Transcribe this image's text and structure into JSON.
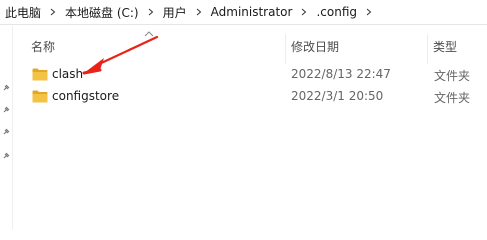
{
  "breadcrumb": [
    {
      "label": "此电脑"
    },
    {
      "label": "本地磁盘 (C:)"
    },
    {
      "label": "用户"
    },
    {
      "label": "Administrator"
    },
    {
      "label": ".config"
    }
  ],
  "columns": {
    "name": "名称",
    "date_modified": "修改日期",
    "type": "类型"
  },
  "files": [
    {
      "name": "clash",
      "date_modified": "2022/8/13 22:47",
      "type": "文件夹",
      "icon": "folder-icon"
    },
    {
      "name": "configstore",
      "date_modified": "2022/3/1 20:50",
      "type": "文件夹",
      "icon": "folder-icon"
    }
  ],
  "annotation": {
    "color": "#e8231a",
    "target": "clash"
  },
  "colors": {
    "folder": "#f5c344",
    "folder_dark": "#e0a72b"
  }
}
